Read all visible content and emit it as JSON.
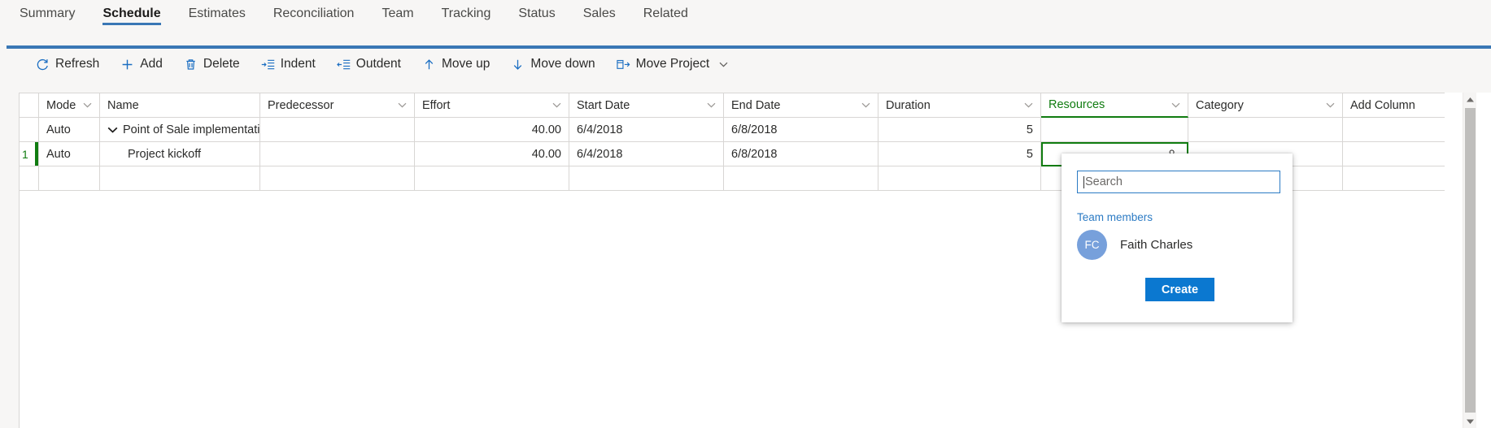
{
  "tabs": [
    {
      "label": "Summary",
      "active": false
    },
    {
      "label": "Schedule",
      "active": true
    },
    {
      "label": "Estimates",
      "active": false
    },
    {
      "label": "Reconciliation",
      "active": false
    },
    {
      "label": "Team",
      "active": false
    },
    {
      "label": "Tracking",
      "active": false
    },
    {
      "label": "Status",
      "active": false
    },
    {
      "label": "Sales",
      "active": false
    },
    {
      "label": "Related",
      "active": false
    }
  ],
  "toolbar": {
    "refresh": "Refresh",
    "add": "Add",
    "delete": "Delete",
    "indent": "Indent",
    "outdent": "Outdent",
    "move_up": "Move up",
    "move_down": "Move down",
    "move_project": "Move Project"
  },
  "grid": {
    "headers": {
      "mode": "Mode",
      "name": "Name",
      "predecessor": "Predecessor",
      "effort": "Effort",
      "start_date": "Start Date",
      "end_date": "End Date",
      "duration": "Duration",
      "resources": "Resources",
      "category": "Category",
      "add_column": "Add Column"
    },
    "selected_column": "Resources",
    "selection_color": "#107c10",
    "rows": [
      {
        "num": "",
        "mode": "Auto",
        "name": "Point of Sale implementati",
        "predecessor": "",
        "effort": "40.00",
        "start_date": "6/4/2018",
        "end_date": "6/8/2018",
        "duration": "5",
        "resources": "",
        "category": "",
        "expandable": true,
        "indented": false,
        "selected": false
      },
      {
        "num": "1",
        "mode": "Auto",
        "name": "Project kickoff",
        "predecessor": "",
        "effort": "40.00",
        "start_date": "6/4/2018",
        "end_date": "6/8/2018",
        "duration": "5",
        "resources": "",
        "category": "",
        "expandable": false,
        "indented": true,
        "selected": true
      },
      {
        "num": "",
        "mode": "",
        "name": "",
        "predecessor": "",
        "effort": "",
        "start_date": "",
        "end_date": "",
        "duration": "",
        "resources": "",
        "category": "",
        "expandable": false,
        "indented": false,
        "selected": false
      }
    ]
  },
  "flyout": {
    "search_placeholder": "Search",
    "search_value": "",
    "section_label": "Team members",
    "members": [
      {
        "initials": "FC",
        "name": "Faith Charles",
        "avatar_color": "#77a0db"
      }
    ],
    "create_label": "Create"
  },
  "colors": {
    "accent_blue": "#3a77b5",
    "icon_blue": "#1b6ec2",
    "selection_green": "#107c10",
    "primary_button": "#0b78d0",
    "page_background": "#f7f6f5"
  }
}
